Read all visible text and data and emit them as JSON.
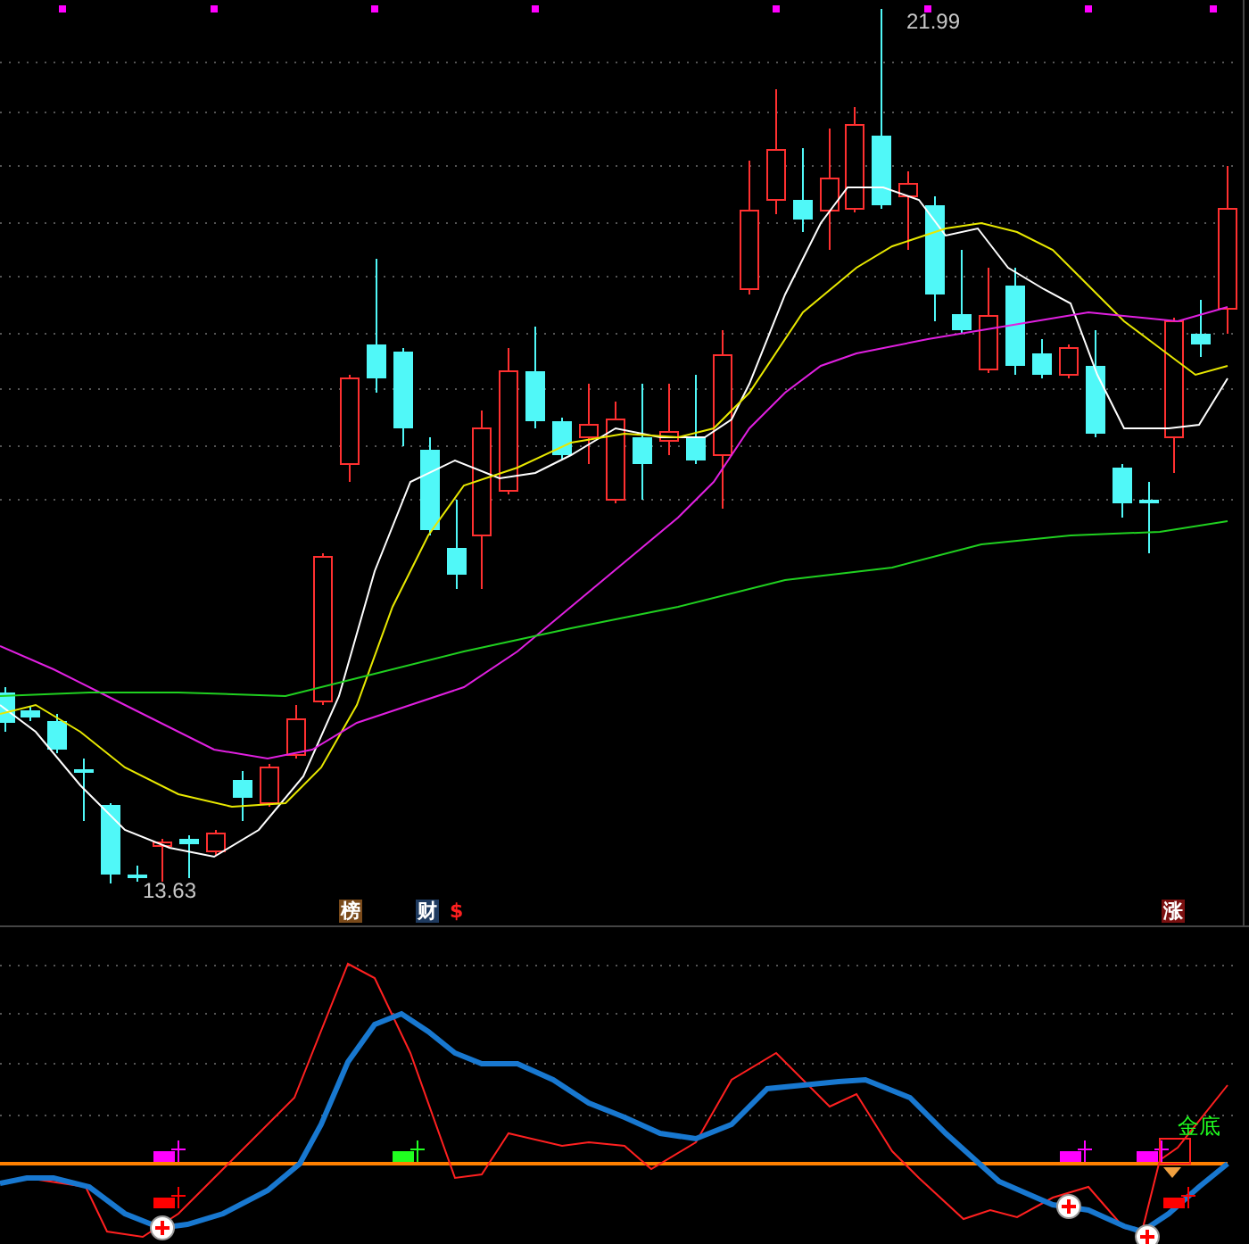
{
  "price_chart": {
    "high_label": "21.99",
    "low_label": "13.63"
  },
  "event_tags": [
    {
      "text": "榜",
      "kind": "badge",
      "color": "#7a4a1a"
    },
    {
      "text": "财",
      "kind": "badge",
      "color": "#1e3a5f"
    },
    {
      "text": "$",
      "kind": "symbol",
      "color": "#ff2020"
    },
    {
      "text": "涨",
      "kind": "badge",
      "color": "#7a1010"
    }
  ],
  "indicator": {
    "signal_label": "金底"
  }
}
